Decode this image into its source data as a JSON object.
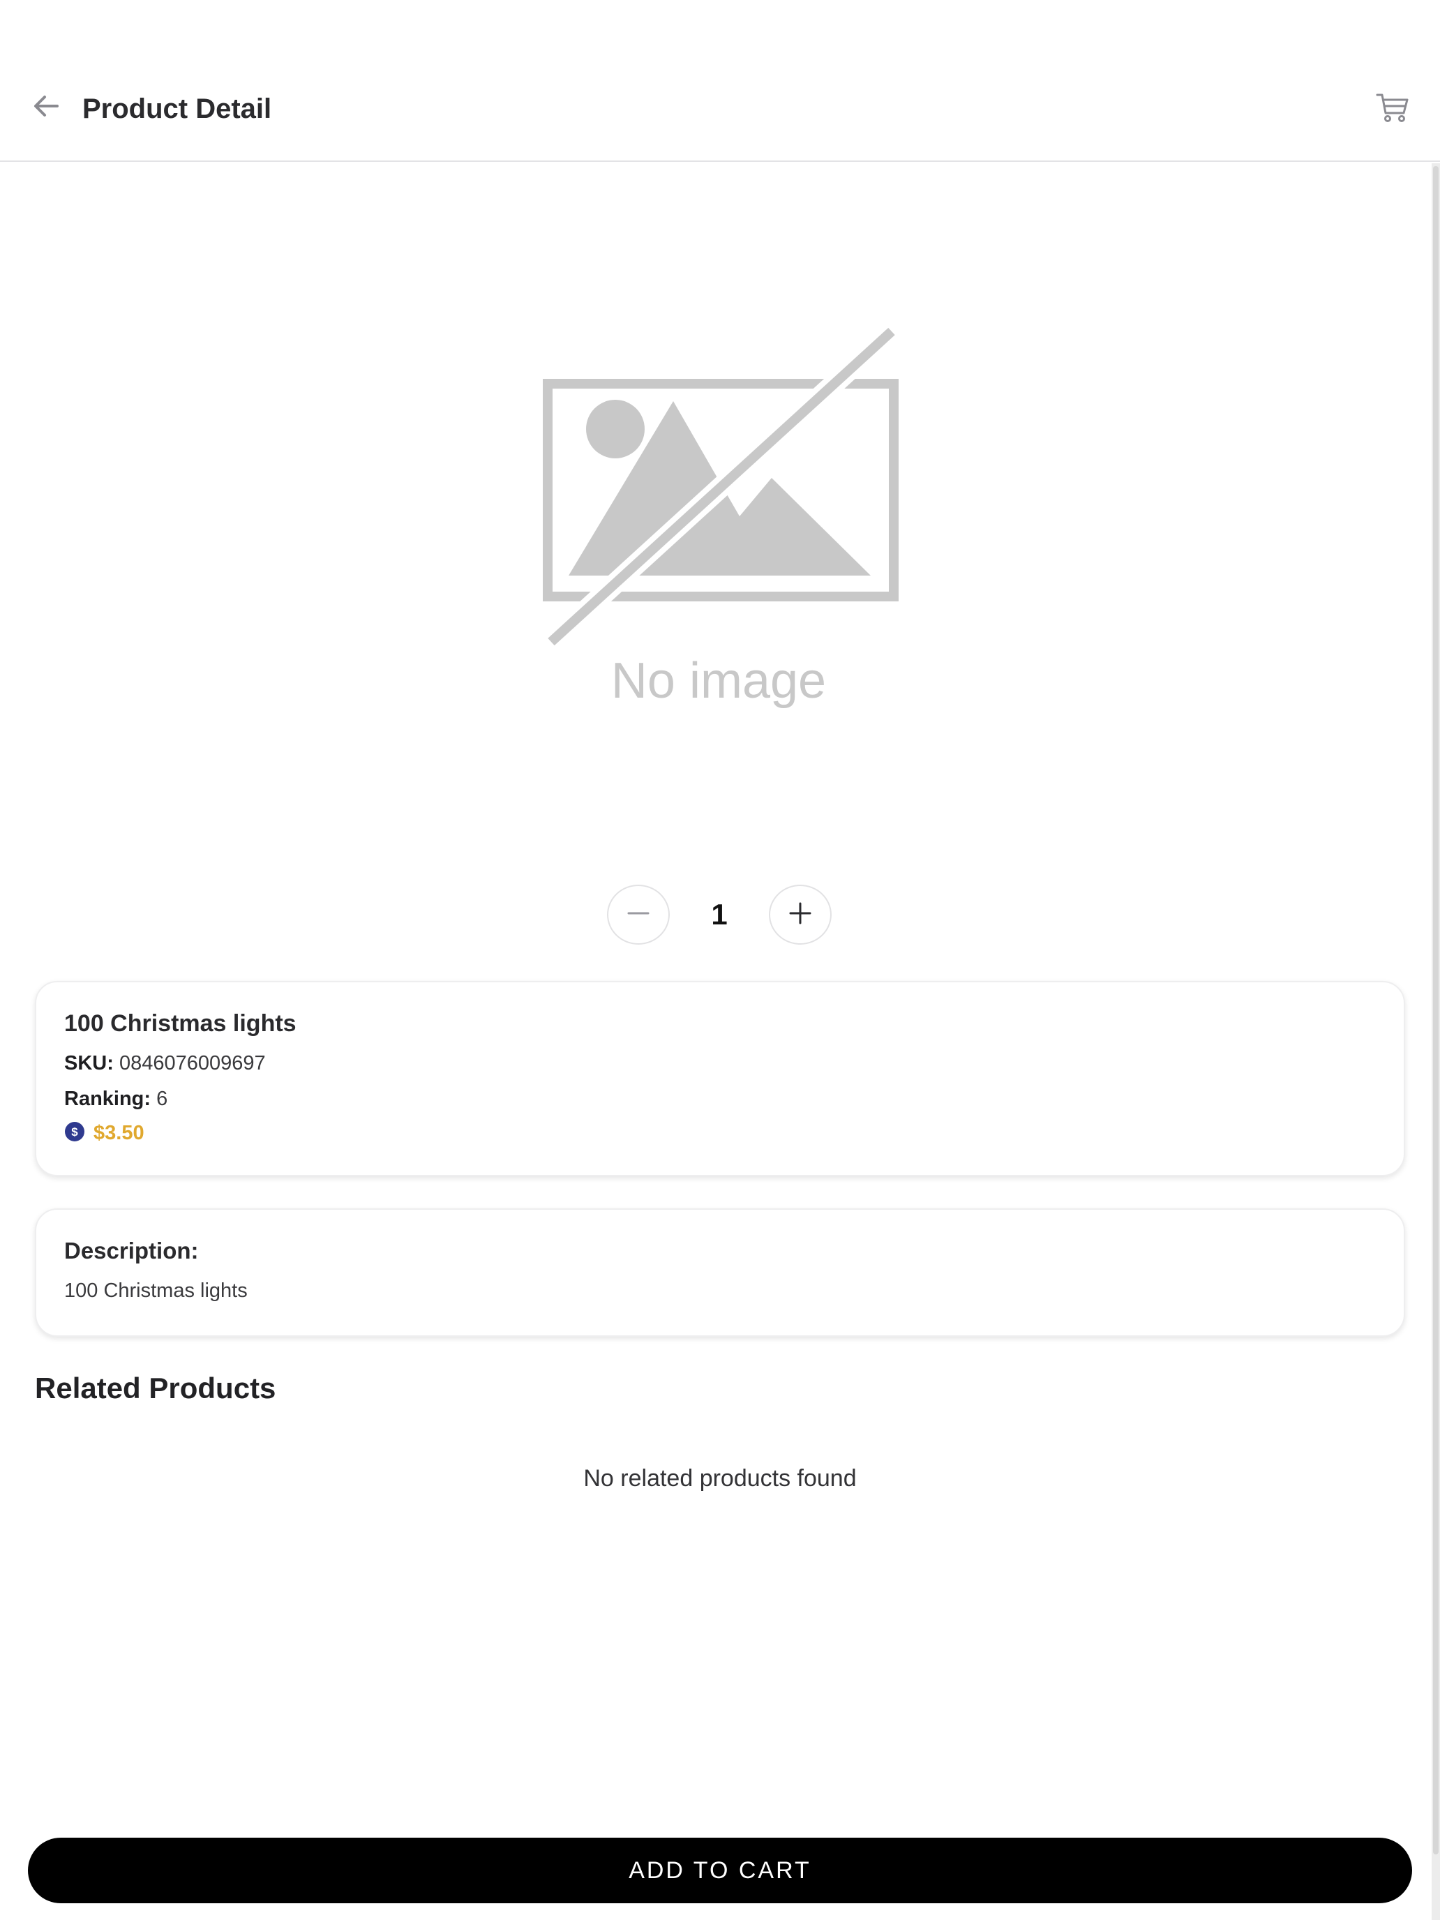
{
  "header": {
    "title": "Product Detail",
    "back_icon": "arrow-left-icon",
    "cart_icon": "shopping-cart-icon"
  },
  "image": {
    "placeholder_text": "No image"
  },
  "quantity": {
    "value": "1",
    "minus_icon": "minus-icon",
    "plus_icon": "plus-icon"
  },
  "product": {
    "name": "100 Christmas lights",
    "sku_label": "SKU:",
    "sku": "0846076009697",
    "ranking_label": "Ranking:",
    "ranking": "6",
    "price": "$3.50",
    "price_icon": "dollar-coin-icon"
  },
  "description": {
    "label": "Description:",
    "text": "100 Christmas lights"
  },
  "related": {
    "title": "Related Products",
    "empty_text": "No related products found"
  },
  "actions": {
    "add_to_cart": "ADD TO CART"
  },
  "colors": {
    "price": "#e0a82e",
    "coin": "#2f3a8f",
    "button": "#000000",
    "placeholder": "#c8c8c8"
  }
}
